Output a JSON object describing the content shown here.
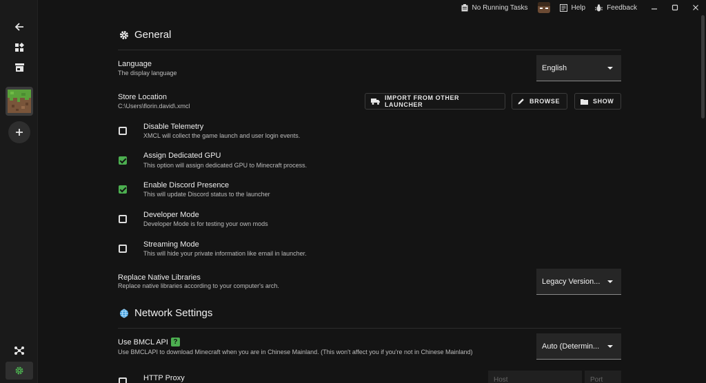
{
  "topbar": {
    "tasks_label": "No Running Tasks",
    "help_label": "Help",
    "feedback_label": "Feedback"
  },
  "general": {
    "title": "General",
    "language": {
      "title": "Language",
      "sub": "The display language",
      "value": "English"
    },
    "store": {
      "title": "Store Location",
      "path": "C:\\Users\\florin.david\\.xmcl",
      "import_label": "IMPORT FROM OTHER LAUNCHER",
      "browse_label": "BROWSE",
      "show_label": "SHOW"
    },
    "options": [
      {
        "title": "Disable Telemetry",
        "sub": "XMCL will collect the game launch and user login events.",
        "checked": false
      },
      {
        "title": "Assign Dedicated GPU",
        "sub": "This option will assign dedicated GPU to Minecraft process.",
        "checked": true
      },
      {
        "title": "Enable Discord Presence",
        "sub": "This will update Discord status to the launcher",
        "checked": true
      },
      {
        "title": "Developer Mode",
        "sub": "Developer Mode is for testing your own mods",
        "checked": false
      },
      {
        "title": "Streaming Mode",
        "sub": "This will hide your private information like email in launcher.",
        "checked": false
      }
    ],
    "native": {
      "title": "Replace Native Libraries",
      "sub": "Replace native libraries according to your computer's arch.",
      "value": "Legacy Version..."
    }
  },
  "network": {
    "title": "Network Settings",
    "bmcl": {
      "title": "Use BMCL API",
      "badge": "?",
      "sub": "Use BMCLAPI to download Minecraft when you are in Chinese Mainland. (This won't affect you if you're not in Chinese Mainland)",
      "value": "Auto (Determin..."
    },
    "proxy": {
      "title": "HTTP Proxy",
      "host_placeholder": "Host",
      "port_placeholder": "Port",
      "checked": false
    }
  },
  "colors": {
    "accent": "#4caf50",
    "background": "#141414",
    "sidebar": "#1a1a1a"
  }
}
